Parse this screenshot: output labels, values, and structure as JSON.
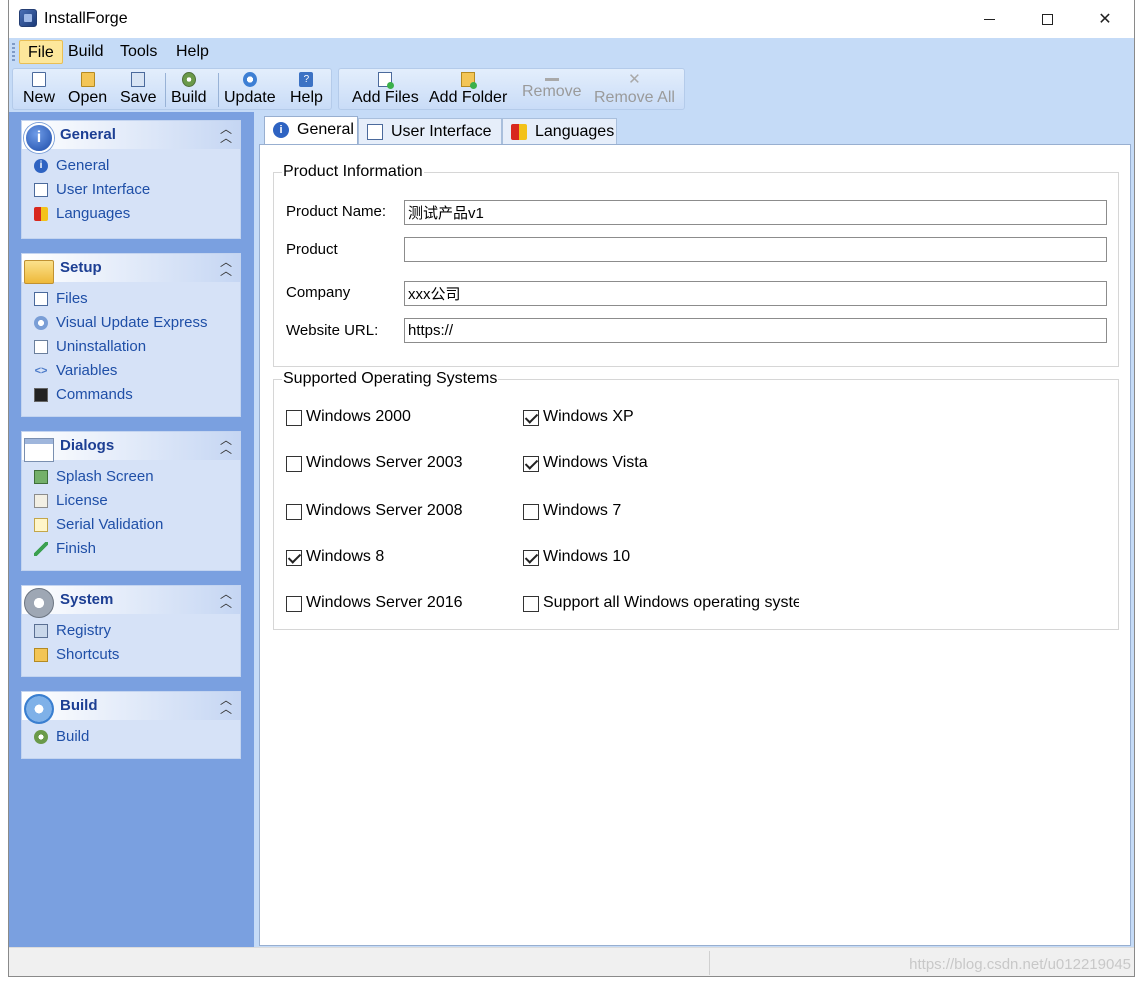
{
  "window": {
    "title": "InstallForge"
  },
  "menu": {
    "file": "File",
    "build": "Build",
    "tools": "Tools",
    "help": "Help"
  },
  "toolbar": {
    "new": "New",
    "open": "Open",
    "save": "Save",
    "build": "Build",
    "update": "Update",
    "help": "Help",
    "add_files": "Add Files",
    "add_folder": "Add Folder",
    "remove": "Remove",
    "remove_all": "Remove All"
  },
  "sidebar": {
    "general": {
      "title": "General",
      "items": [
        "General",
        "User Interface",
        "Languages"
      ]
    },
    "setup": {
      "title": "Setup",
      "items": [
        "Files",
        "Visual Update Express",
        "Uninstallation",
        "Variables",
        "Commands"
      ]
    },
    "dialogs": {
      "title": "Dialogs",
      "items": [
        "Splash Screen",
        "License",
        "Serial Validation",
        "Finish"
      ]
    },
    "system": {
      "title": "System",
      "items": [
        "Registry",
        "Shortcuts"
      ]
    },
    "build": {
      "title": "Build",
      "items": [
        "Build"
      ]
    }
  },
  "tabs": {
    "general": "General",
    "user_interface": "User Interface",
    "languages": "Languages"
  },
  "product_info": {
    "legend": "Product Information",
    "name_label": "Product Name:",
    "name_value": "测试产品v1",
    "product_label": "Product",
    "product_value": "",
    "company_label": "Company",
    "company_value": "xxx公司",
    "url_label": "Website URL:",
    "url_value": "https://"
  },
  "os": {
    "legend": "Supported Operating Systems",
    "items": [
      {
        "label": "Windows 2000",
        "checked": false
      },
      {
        "label": "Windows XP",
        "checked": true
      },
      {
        "label": "Windows Server 2003",
        "checked": false
      },
      {
        "label": "Windows Vista",
        "checked": true
      },
      {
        "label": "Windows Server 2008",
        "checked": false
      },
      {
        "label": "Windows 7",
        "checked": false
      },
      {
        "label": "Windows 8",
        "checked": true
      },
      {
        "label": "Windows 10",
        "checked": true
      },
      {
        "label": "Windows Server 2016",
        "checked": false
      },
      {
        "label": "Support all Windows operating systems",
        "checked": false
      }
    ]
  },
  "watermark": "https://blog.csdn.net/u012219045",
  "colors": {
    "sidebar_bg": "#7aa0e0",
    "menubar_bg": "#c5dbf7",
    "panel_title": "#1d3f93",
    "link": "#1f4fa7"
  }
}
